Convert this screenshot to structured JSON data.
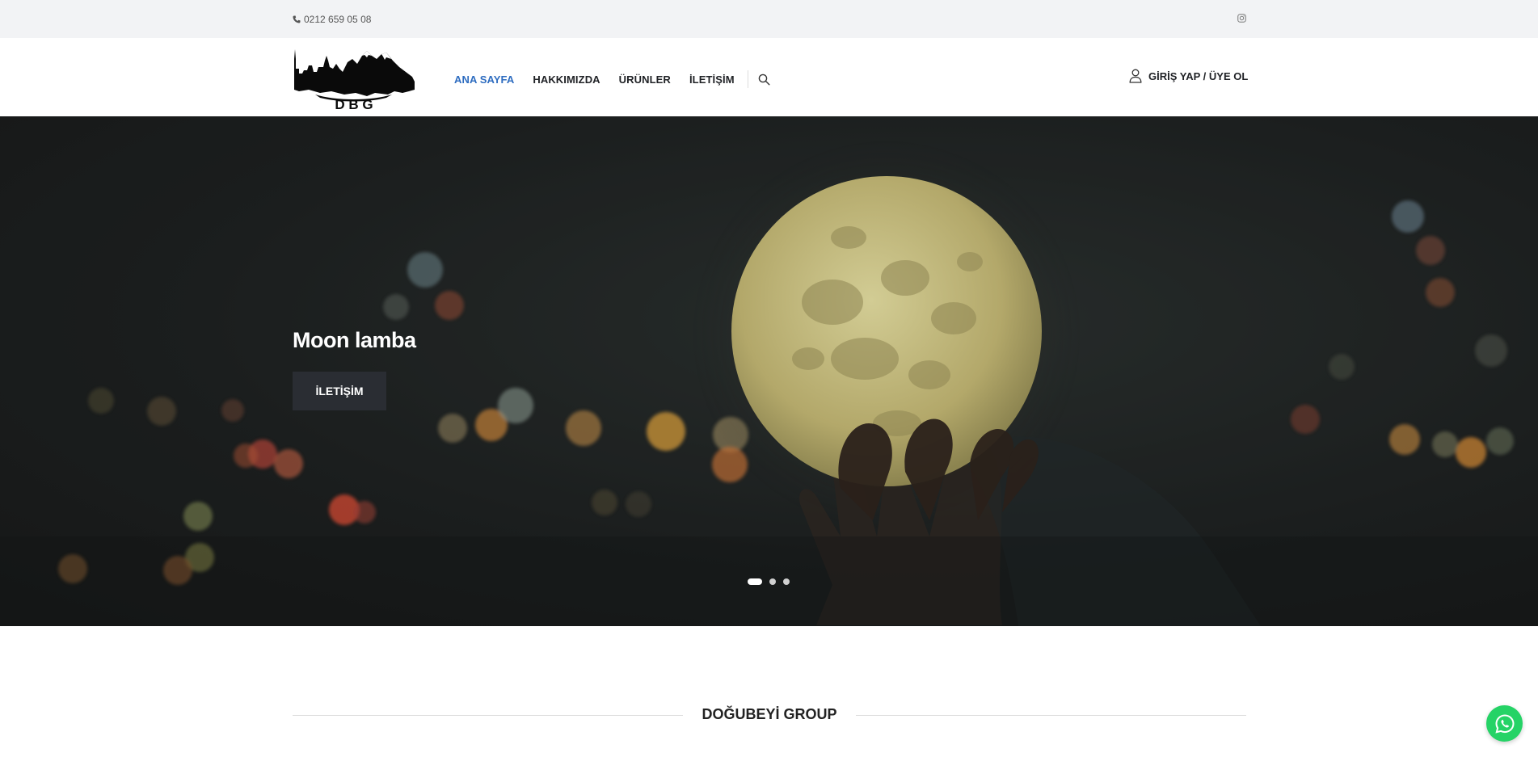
{
  "topbar": {
    "phone": "0212 659 05 08",
    "phone_icon": "phone-icon",
    "social_icon": "instagram-icon"
  },
  "header": {
    "logo_text": "D B G",
    "nav": {
      "home": "ANA SAYFA",
      "about": "HAKKIMIZDA",
      "products": "ÜRÜNLER",
      "contact": "İLETİŞİM"
    },
    "search_icon": "search-icon",
    "login_label": "GİRİŞ YAP / ÜYE OL",
    "user_icon": "user-icon",
    "active_color": "#2d6cc0"
  },
  "hero": {
    "title": "Moon lamba",
    "button_label": "İLETİŞİM",
    "slides_count": 3,
    "active_slide": 1
  },
  "section": {
    "title": "DOĞUBEYİ GROUP"
  },
  "floating": {
    "whatsapp_icon": "whatsapp-icon",
    "whatsapp_color": "#25d366"
  }
}
